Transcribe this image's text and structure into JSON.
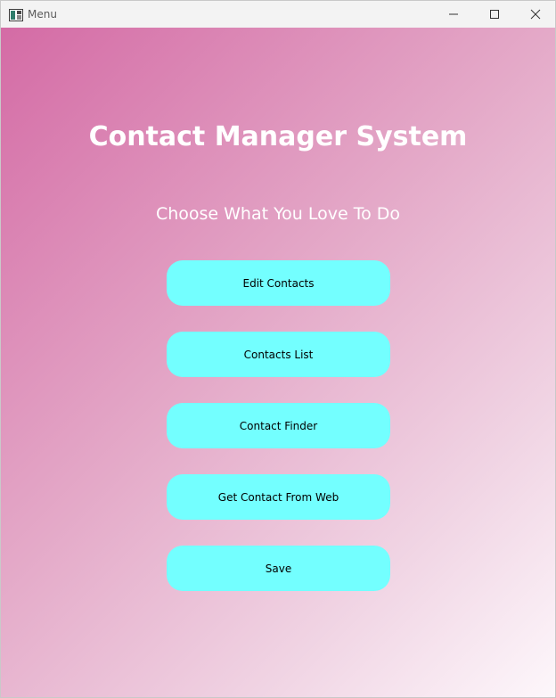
{
  "window": {
    "title": "Menu",
    "icon": "app-window-icon",
    "controls": [
      "minimize-icon",
      "maximize-icon",
      "close-icon"
    ]
  },
  "main": {
    "title": "Contact Manager System",
    "subtitle": "Choose What You Love To Do",
    "buttons": [
      {
        "label": "Edit Contacts"
      },
      {
        "label": "Contacts List"
      },
      {
        "label": "Contact Finder"
      },
      {
        "label": "Get Contact From Web"
      },
      {
        "label": "Save"
      }
    ]
  },
  "colors": {
    "button_bg": "#73ffff",
    "gradient_start": "#d46ba5",
    "gradient_end": "#fdf7fb",
    "heading_text": "#ffffff"
  }
}
